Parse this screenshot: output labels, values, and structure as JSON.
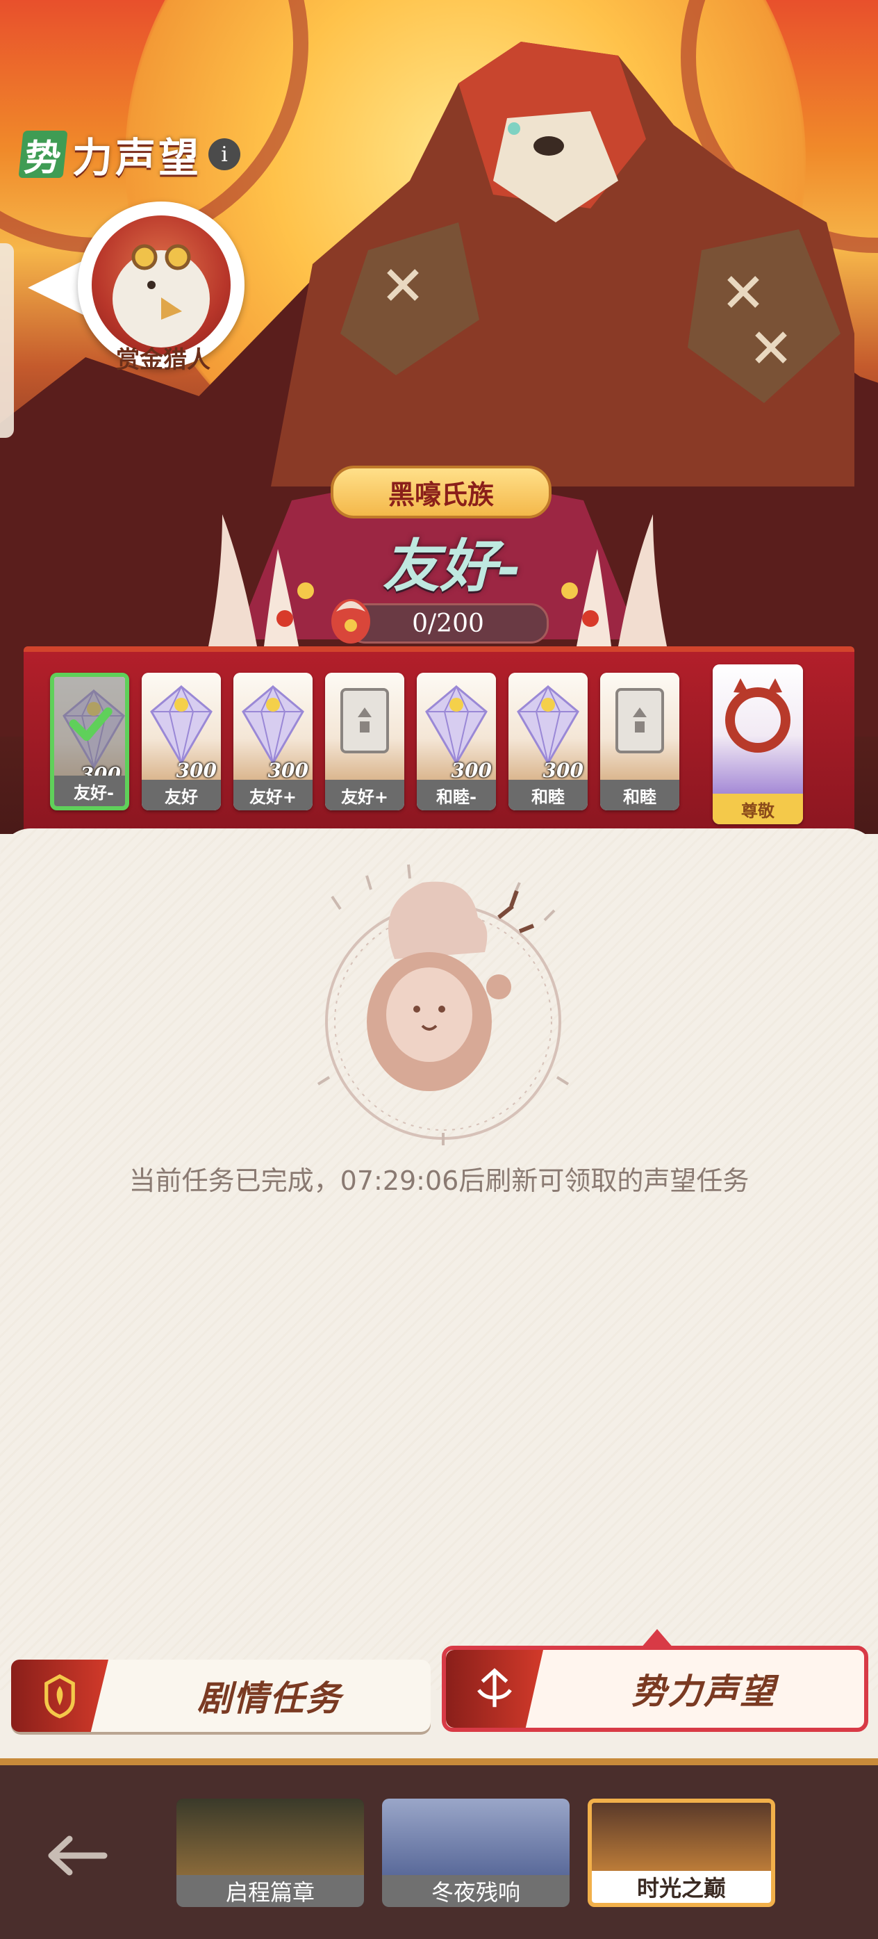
{
  "header": {
    "title_badge": "势",
    "title": "力声望",
    "info_label": "i"
  },
  "hunter": {
    "label": "赏金猎人"
  },
  "faction": {
    "name": "黑嚎氏族",
    "level": "友好-",
    "progress_text": "0/200",
    "progress_fraction": 0
  },
  "rewards": [
    {
      "label": "友好-",
      "qty": "300",
      "kind": "diamond",
      "claimed": true
    },
    {
      "label": "友好",
      "qty": "300",
      "kind": "diamond",
      "claimed": false
    },
    {
      "label": "友好+",
      "qty": "300",
      "kind": "diamond",
      "claimed": false
    },
    {
      "label": "友好+",
      "qty": "",
      "kind": "card",
      "claimed": false
    },
    {
      "label": "和睦-",
      "qty": "300",
      "kind": "diamond",
      "claimed": false
    },
    {
      "label": "和睦",
      "qty": "300",
      "kind": "diamond",
      "claimed": false
    },
    {
      "label": "和睦",
      "qty": "",
      "kind": "card",
      "claimed": false
    },
    {
      "label": "尊敬",
      "qty": "",
      "kind": "frame",
      "claimed": false
    }
  ],
  "status": {
    "text": "当前任务已完成，07:29:06后刷新可领取的声望任务"
  },
  "tabs": {
    "story": "剧情任务",
    "reputation": "势力声望",
    "active": "reputation"
  },
  "chapters": [
    {
      "name": "启程篇章",
      "active": false
    },
    {
      "name": "冬夜残响",
      "active": false
    },
    {
      "name": "时光之巅",
      "active": true
    }
  ],
  "colors": {
    "accent": "#d83a46",
    "claimed": "#5fd05a",
    "gold": "#f2b04a"
  }
}
